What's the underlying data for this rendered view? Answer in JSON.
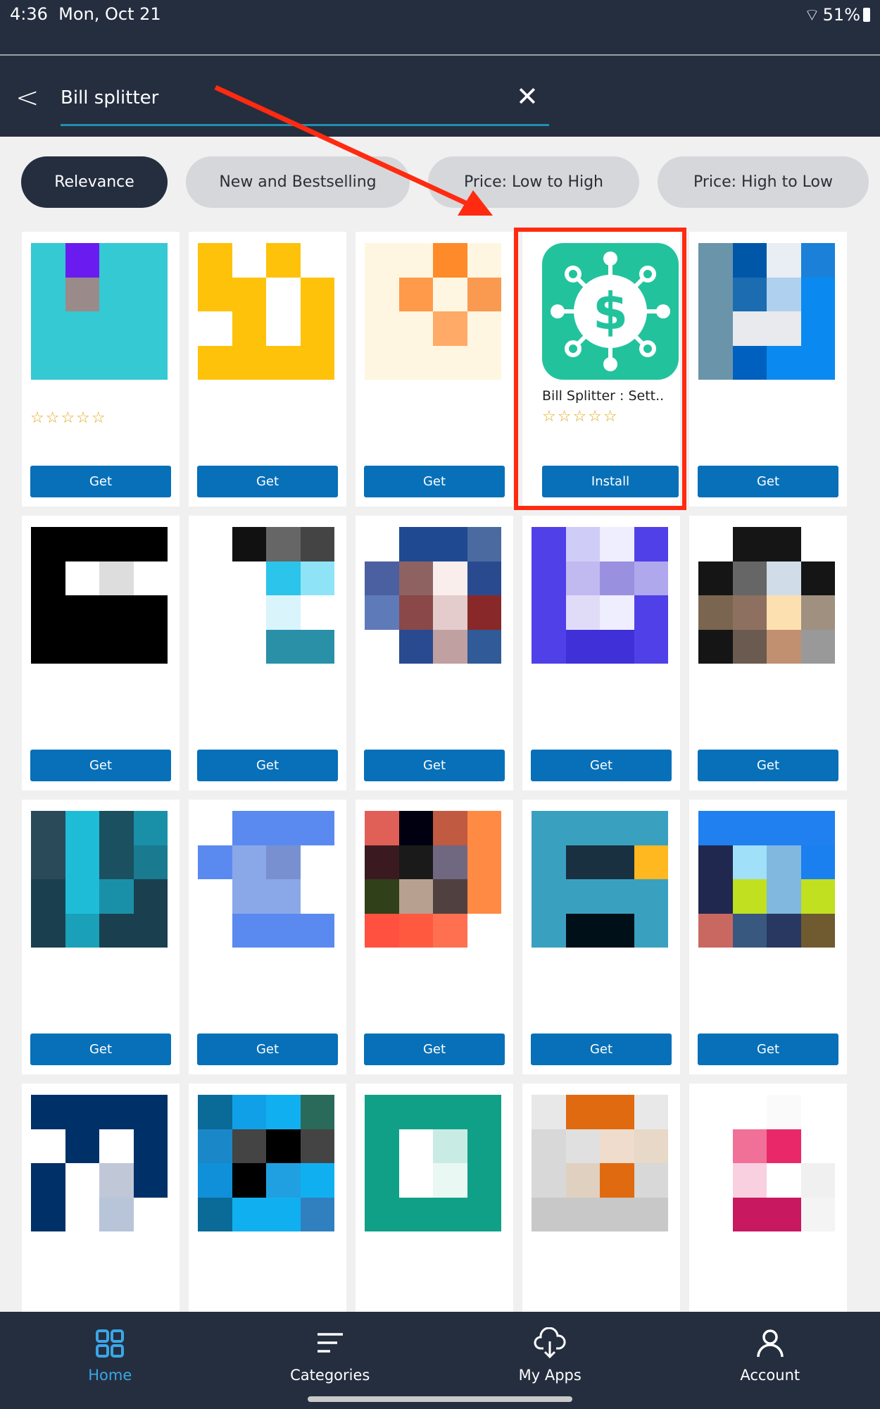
{
  "status": {
    "time": "4:36",
    "date": "Mon, Oct 21",
    "battery": "51%"
  },
  "search": {
    "value": "Bill splitter"
  },
  "filters": [
    {
      "label": "Relevance",
      "active": true
    },
    {
      "label": "New and Bestselling"
    },
    {
      "label": "Price: Low to High"
    },
    {
      "label": "Price: High to Low"
    }
  ],
  "featured": {
    "name": "Bill Splitter : Sett..",
    "button": "Install",
    "rating": "☆☆☆☆☆",
    "icon": "dollar-network-icon",
    "color": "#22c39c",
    "highlight": "#ff2a10"
  },
  "get_label": "Get",
  "stars": "☆☆☆☆☆",
  "tiles": [
    [
      "#35c9d3",
      "#6a1cf0",
      "#35c9d3",
      "#35c9d3",
      "#35c9d3",
      "#9a8a8a",
      "#35c9d3",
      "#35c9d3",
      "#35c9d3",
      "#35c9d3",
      "#35c9d3",
      "#35c9d3",
      "#35c9d3",
      "#35c9d3",
      "#35c9d3",
      "#35c9d3"
    ],
    [
      "#fec20a",
      "#fff",
      "#fec20a",
      "#fff",
      "#fec20a",
      "#fec20a",
      "#fff",
      "#fec20a",
      "#fff",
      "#fec20a",
      "#fff",
      "#fec20a",
      "#fec20a",
      "#fec20a",
      "#fec20a",
      "#fec20a"
    ],
    [
      "#fff6e2",
      "#fff6e2",
      "#ff8a2a",
      "#fff6e2",
      "#fff6e2",
      "#ff9a4a",
      "#fff6e2",
      "#fa9a50",
      "#fff6e2",
      "#fff6e2",
      "#ffaa66",
      "#fff6e2",
      "#fff6e2",
      "#fff6e2",
      "#fff6e2",
      "#fff6e2"
    ],
    null,
    [
      "#6a94aa",
      "#0057a8",
      "#e8eef4",
      "#1a80d8",
      "#6a94aa",
      "#1b6cb0",
      "#b0d0f0",
      "#0a8af0",
      "#6a94aa",
      "#e8eaee",
      "#e8eaee",
      "#0a8af0",
      "#6a94aa",
      "#0060c0",
      "#0a8af0",
      "#0a8af0"
    ],
    [
      "#000",
      "#000",
      "#000",
      "#000",
      "#000",
      "#fff",
      "#ddd",
      "#fff",
      "#000",
      "#000",
      "#000",
      "#000",
      "#000",
      "#000",
      "#000",
      "#000"
    ],
    [
      "#fff",
      "#111",
      "#666",
      "#444",
      "#fff",
      "#fff",
      "#2cc4ea",
      "#8ee4f6",
      "#fff",
      "#fff",
      "#daf4fc",
      "#fff",
      "#fff",
      "#fff",
      "#2a90a8",
      "#2a90a8"
    ],
    [
      "#fff",
      "#1f4a92",
      "#1f4a92",
      "#4a6aa0",
      "#4a60a0",
      "#8f6262",
      "#f9eeec",
      "#2a4a90",
      "#5f7ab8",
      "#8a4848",
      "#e4cccc",
      "#882828",
      "#fff",
      "#2a4a90",
      "#c0a0a0",
      "#305a98"
    ],
    [
      "#5040e8",
      "#d0ccf8",
      "#eeeeff",
      "#5040e8",
      "#5040e8",
      "#c0baf0",
      "#9a90e0",
      "#b0a8ec",
      "#5040e8",
      "#e0dcf8",
      "#eeeeff",
      "#5040e8",
      "#5040e8",
      "#4030d8",
      "#4030d8",
      "#5040e8"
    ],
    [
      "#fff",
      "#151515",
      "#151515",
      "#fff",
      "#151515",
      "#666",
      "#d0dce8",
      "#151515",
      "#7a6550",
      "#8e7060",
      "#fce0b0",
      "#a09080",
      "#151515",
      "#6a5a50",
      "#c09070",
      "#999"
    ],
    [
      "#2a4a5a",
      "#1fbcd8",
      "#1a5060",
      "#1a90a8",
      "#2a4a5a",
      "#1fbcd8",
      "#1a5060",
      "#1a7a90",
      "#1a4050",
      "#1fbcd8",
      "#1a90a8",
      "#1a4050",
      "#1a4050",
      "#1aa0b8",
      "#1a4050",
      "#1a4050"
    ],
    [
      "#fff",
      "#5a8af0",
      "#5a8af0",
      "#5a8af0",
      "#5a8af0",
      "#8aa8e8",
      "#7890d0",
      "#fff",
      "#fff",
      "#8aa8e8",
      "#8aa8e8",
      "#fff",
      "#fff",
      "#5a8af0",
      "#5a8af0",
      "#5a8af0"
    ],
    [
      "#e06058",
      "#000010",
      "#c05a40",
      "#ff8a44",
      "#3a1a20",
      "#1a1a1a",
      "#706880",
      "#ff8a44",
      "#304018",
      "#b8a090",
      "#504040",
      "#ff8a44",
      "#ff5040",
      "#ff5a40",
      "#ff7050",
      "#fff"
    ],
    [
      "#3aa0c0",
      "#3aa0c0",
      "#3aa0c0",
      "#3aa0c0",
      "#3aa0c0",
      "#183040",
      "#183040",
      "#ffb820",
      "#3aa0c0",
      "#3aa0c0",
      "#3aa0c0",
      "#3aa0c0",
      "#3aa0c0",
      "#001018",
      "#001018",
      "#3aa0c0"
    ],
    [
      "#2080f0",
      "#2080f0",
      "#2080f0",
      "#2080f0",
      "#202850",
      "#a0e0f8",
      "#80b8e0",
      "#1a80f0",
      "#202850",
      "#c0e020",
      "#80b8e0",
      "#c0e020",
      "#c86860",
      "#385880",
      "#283860",
      "#705a30"
    ],
    [
      "#003068",
      "#003068",
      "#003068",
      "#003068",
      "#fff",
      "#003068",
      "#fff",
      "#003068",
      "#003068",
      "#fff",
      "#c0c8d8",
      "#003068",
      "#003068",
      "#fff",
      "#b8c4d8",
      "#fff"
    ],
    [
      "#0a6a98",
      "#10a0e8",
      "#10b0f0",
      "#2a6a5a",
      "#1a88c8",
      "#444",
      "#000",
      "#444",
      "#1090d8",
      "#000",
      "#20a0e0",
      "#10b0f0",
      "#0a6a98",
      "#10b0f0",
      "#10b0f0",
      "#3080c0"
    ],
    [
      "#10a088",
      "#10a088",
      "#10a088",
      "#10a088",
      "#10a088",
      "#fff",
      "#c8ece4",
      "#10a088",
      "#10a088",
      "#fff",
      "#eaf8f4",
      "#10a088",
      "#10a088",
      "#10a088",
      "#10a088",
      "#10a088"
    ],
    [
      "#e8e8e8",
      "#e06a10",
      "#e06a10",
      "#e8e8e8",
      "#d8d8d8",
      "#e0e0e0",
      "#f0dccc",
      "#e8d8c8",
      "#d8d8d8",
      "#e0d0c0",
      "#e06a10",
      "#d8d8d8",
      "#c8c8c8",
      "#c8c8c8",
      "#c8c8c8",
      "#c8c8c8"
    ],
    [
      "#fff",
      "#fff",
      "#fafafa",
      "#fff",
      "#fff",
      "#f07098",
      "#e82868",
      "#fff",
      "#fff",
      "#f8d0e0",
      "#fff",
      "#f0f0f0",
      "#fff",
      "#c81860",
      "#c81860",
      "#f4f4f4"
    ]
  ],
  "nav": [
    {
      "label": "Home",
      "icon": "grid-icon",
      "active": true
    },
    {
      "label": "Categories",
      "icon": "list-icon"
    },
    {
      "label": "My Apps",
      "icon": "cloud-download-icon"
    },
    {
      "label": "Account",
      "icon": "user-icon"
    }
  ],
  "colors": {
    "accent": "#0770b8",
    "header": "#242e3f",
    "nav_active": "#3ba6e6",
    "annotation": "#ff2a10"
  }
}
